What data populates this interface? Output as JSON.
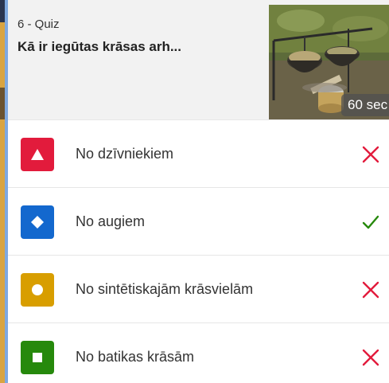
{
  "quiz": {
    "label": "6 - Quiz",
    "title": "Kā ir iegūtas krāsas arh...",
    "timer": "60 sec"
  },
  "answers": [
    {
      "text": "No dzīvniekiem",
      "shape": "triangle-icon",
      "color": "#e21b3c",
      "result": "incorrect"
    },
    {
      "text": "No augiem",
      "shape": "diamond-icon",
      "color": "#1368ce",
      "result": "correct"
    },
    {
      "text": "No sintētiskajām krāsvielām",
      "shape": "circle-icon",
      "color": "#d89e00",
      "result": "incorrect"
    },
    {
      "text": "No batikas krāsām",
      "shape": "square-icon",
      "color": "#26890c",
      "result": "incorrect"
    }
  ],
  "colors": {
    "incorrect": "#e21b3c",
    "correct": "#26890c",
    "frame": "#8fb6ea"
  }
}
